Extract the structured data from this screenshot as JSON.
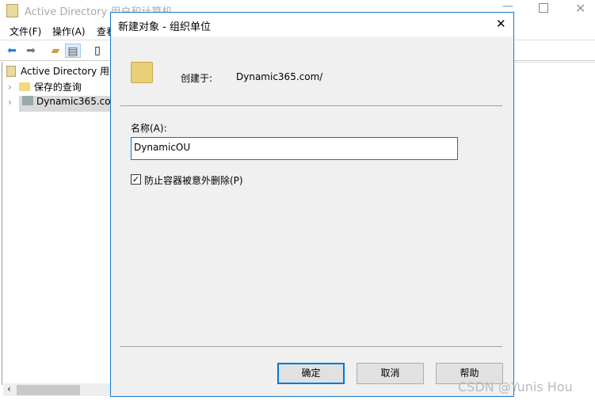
{
  "app": {
    "title": "Active Directory 用户和计算机",
    "menu": [
      "文件(F)",
      "操作(A)",
      "查看"
    ],
    "tree": [
      {
        "label": "Active Directory 用户和计算机"
      },
      {
        "label": "保存的查询"
      },
      {
        "label": "Dynamic365.com"
      }
    ]
  },
  "dialog": {
    "title": "新建对象 - 组织单位",
    "created_in_label": "创建于:",
    "created_in_value": "Dynamic365.com/",
    "name_label": "名称(A):",
    "name_value": "DynamicOU",
    "protect_label": "防止容器被意外删除(P)",
    "protect_checked": true,
    "ok": "确定",
    "cancel": "取消",
    "help": "帮助"
  },
  "watermark": "CSDN @Yunis Hou"
}
